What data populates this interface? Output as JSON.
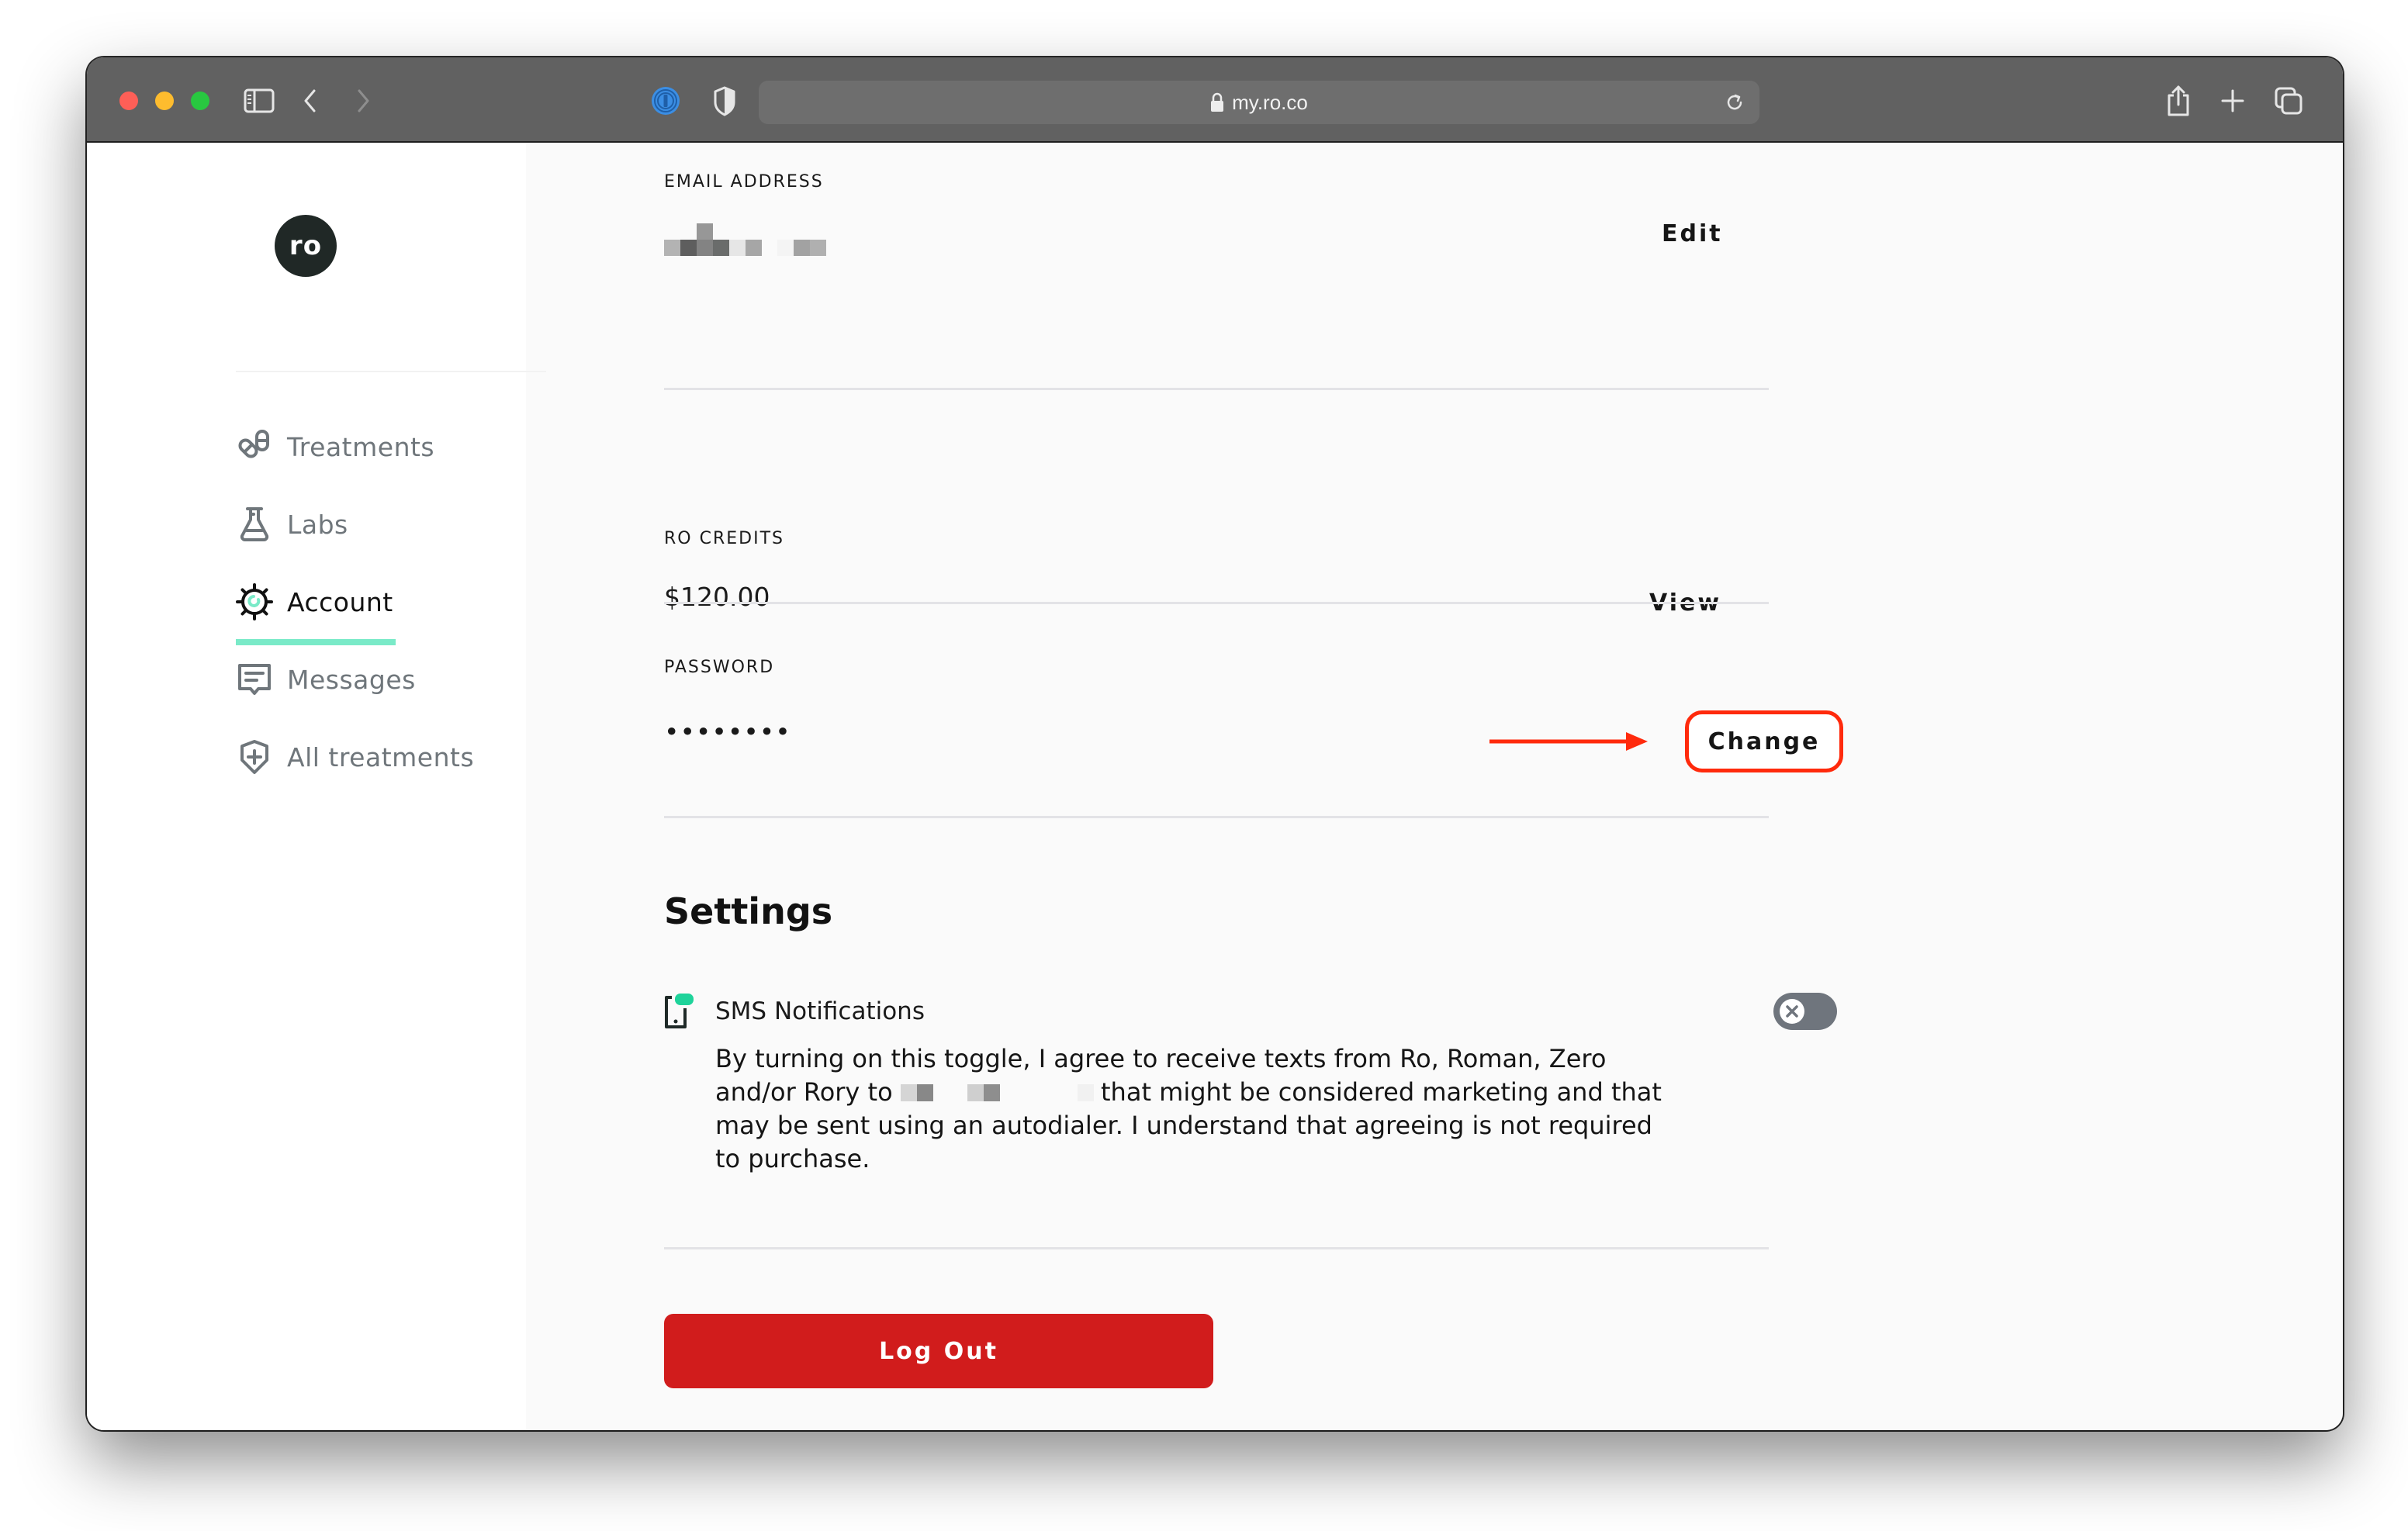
{
  "browser": {
    "url": "my.ro.co",
    "icons": {
      "close": "traffic-light-close",
      "minimize": "traffic-light-minimize",
      "zoom": "traffic-light-zoom",
      "sidebar": "sidebar-icon",
      "back": "chevron-left-icon",
      "forward": "chevron-right-icon",
      "password_manager": "1password-icon",
      "privacy": "shield-icon",
      "lock": "lock-icon",
      "reload": "reload-icon",
      "share": "share-icon",
      "new_tab": "plus-icon",
      "tabs": "tabs-overview-icon"
    }
  },
  "sidebar": {
    "logo_text": "ro",
    "items": [
      {
        "label": "Treatments",
        "icon": "pills-icon",
        "active": false
      },
      {
        "label": "Labs",
        "icon": "flask-icon",
        "active": false
      },
      {
        "label": "Account",
        "icon": "gear-icon",
        "active": true
      },
      {
        "label": "Messages",
        "icon": "message-icon",
        "active": false
      },
      {
        "label": "All treatments",
        "icon": "shield-plus-icon",
        "active": false
      }
    ],
    "accent_color": "#7aeac8"
  },
  "account": {
    "email": {
      "label": "EMAIL ADDRESS",
      "value_redacted": true,
      "action": "Edit"
    },
    "credits": {
      "label": "RO CREDITS",
      "value": "$120.00",
      "action": "View"
    },
    "password": {
      "label": "PASSWORD",
      "value": "••••••••",
      "action": "Change",
      "highlight_color": "#ff2a0c"
    }
  },
  "settings": {
    "title": "Settings",
    "sms": {
      "title": "SMS Notifications",
      "desc_before": "By turning on this toggle, I agree to receive texts from Ro, Roman, Zero and/or Rory to ",
      "desc_after": " that might be considered marketing and that may be sent using an autodialer. I understand that agreeing is not required to purchase.",
      "toggle_on": false
    }
  },
  "logout": {
    "label": "Log Out",
    "color": "#d11c1c"
  }
}
